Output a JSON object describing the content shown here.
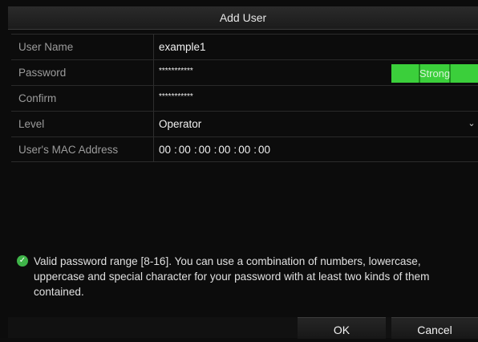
{
  "dialog": {
    "title": "Add User"
  },
  "form": {
    "user_name": {
      "label": "User Name",
      "value": "example1"
    },
    "password": {
      "label": "Password",
      "value": "***********",
      "strength": "Strong"
    },
    "confirm": {
      "label": "Confirm",
      "value": "***********"
    },
    "level": {
      "label": "Level",
      "value": "Operator",
      "arrow": "⌄"
    },
    "mac": {
      "label": "User's MAC Address",
      "octets": [
        "00",
        "00",
        "00",
        "00",
        "00",
        "00"
      ],
      "separator": ":"
    }
  },
  "notice": {
    "icon": "check-circle-icon",
    "text": "Valid password range [8-16]. You can use a combination of numbers, lowercase, uppercase and special character for your password with at least two kinds of them contained."
  },
  "buttons": {
    "ok": "OK",
    "cancel": "Cancel"
  },
  "colors": {
    "strength_bar": "#3bcf3b",
    "notice_icon": "#3fb449"
  }
}
